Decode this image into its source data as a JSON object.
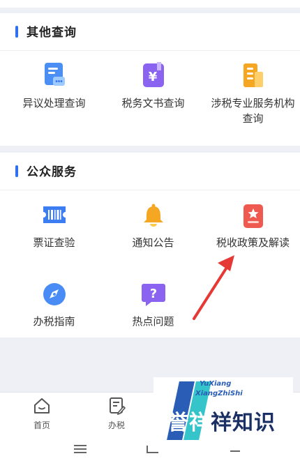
{
  "other_query": {
    "title": "其他查询",
    "items": [
      {
        "label": "异议处理查询",
        "icon": "objection-document-icon"
      },
      {
        "label": "税务文书查询",
        "icon": "tax-document-yen-icon"
      },
      {
        "label_line1": "涉税专业服务机构",
        "label_line2": "查询",
        "icon": "service-agency-building-icon"
      }
    ]
  },
  "public_service": {
    "title": "公众服务",
    "items": [
      {
        "label": "票证查验",
        "icon": "ticket-barcode-icon"
      },
      {
        "label": "通知公告",
        "icon": "bell-icon"
      },
      {
        "label": "税收政策及解读",
        "icon": "policy-star-document-icon"
      },
      {
        "label": "办税指南",
        "icon": "compass-icon"
      },
      {
        "label": "热点问题",
        "icon": "question-bubble-icon"
      }
    ]
  },
  "tabbar": {
    "items": [
      {
        "label": "首页",
        "icon": "home-icon"
      },
      {
        "label": "办税",
        "icon": "edit-document-icon"
      }
    ]
  },
  "watermark": {
    "line1": "YuXiang",
    "line2": "XiangZhiShi",
    "main_part1": "誉祥",
    "main_part2": "祥知识"
  },
  "colors": {
    "accent": "#2f6ff0",
    "arrow": "#e53935",
    "page_bg": "#eef0f5"
  }
}
